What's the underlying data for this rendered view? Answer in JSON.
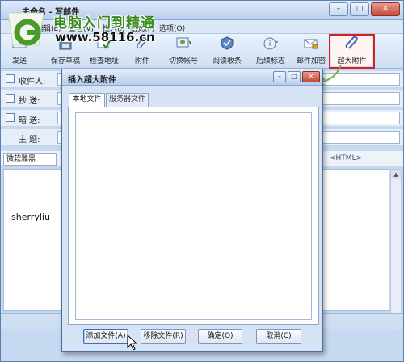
{
  "window": {
    "title": "未命名 - 写邮件",
    "minimize": "–",
    "maximize": "□",
    "close": "✕"
  },
  "menu": [
    "编辑(E)",
    "查看(V)",
    "插入(I)",
    "格式(F)",
    "选项(O)"
  ],
  "watermark": {
    "brand": "电脑入门到精通",
    "url": "www.58116.cn"
  },
  "toolbar": [
    {
      "label": "发送",
      "icon": "send-icon"
    },
    {
      "label": "保存草稿",
      "icon": "save-draft-icon"
    },
    {
      "label": "检查地址",
      "icon": "check-address-icon"
    },
    {
      "label": "附件",
      "icon": "paperclip-icon"
    },
    {
      "label": "切换帐号",
      "icon": "switch-account-icon"
    },
    {
      "label": "阅读收条",
      "icon": "read-receipt-icon"
    },
    {
      "label": "后续标志",
      "icon": "follow-up-flag-icon"
    },
    {
      "label": "邮件加密",
      "icon": "encrypt-icon"
    },
    {
      "label": "超大附件",
      "icon": "large-attachment-icon"
    }
  ],
  "fields": {
    "to_label": "收件人:",
    "cc_label": "抄  送:",
    "bcc_label": "暗  送:",
    "subject_label": "主  题:"
  },
  "format": {
    "font": "微软雅黑",
    "html_mode": "<HTML>"
  },
  "editor": {
    "signature": "sherryliu"
  },
  "dialog": {
    "title": "插入超大附件",
    "tabs": [
      "本地文件",
      "服务器文件"
    ],
    "buttons": {
      "add": "添加文件(A)",
      "remove": "移除文件(R)",
      "ok": "确定(O)",
      "cancel": "取消(C)"
    }
  },
  "colors": {
    "highlight_border": "#d42020",
    "watermark_green": "#3a8a1f",
    "window_frame": "#c6d9f0"
  }
}
